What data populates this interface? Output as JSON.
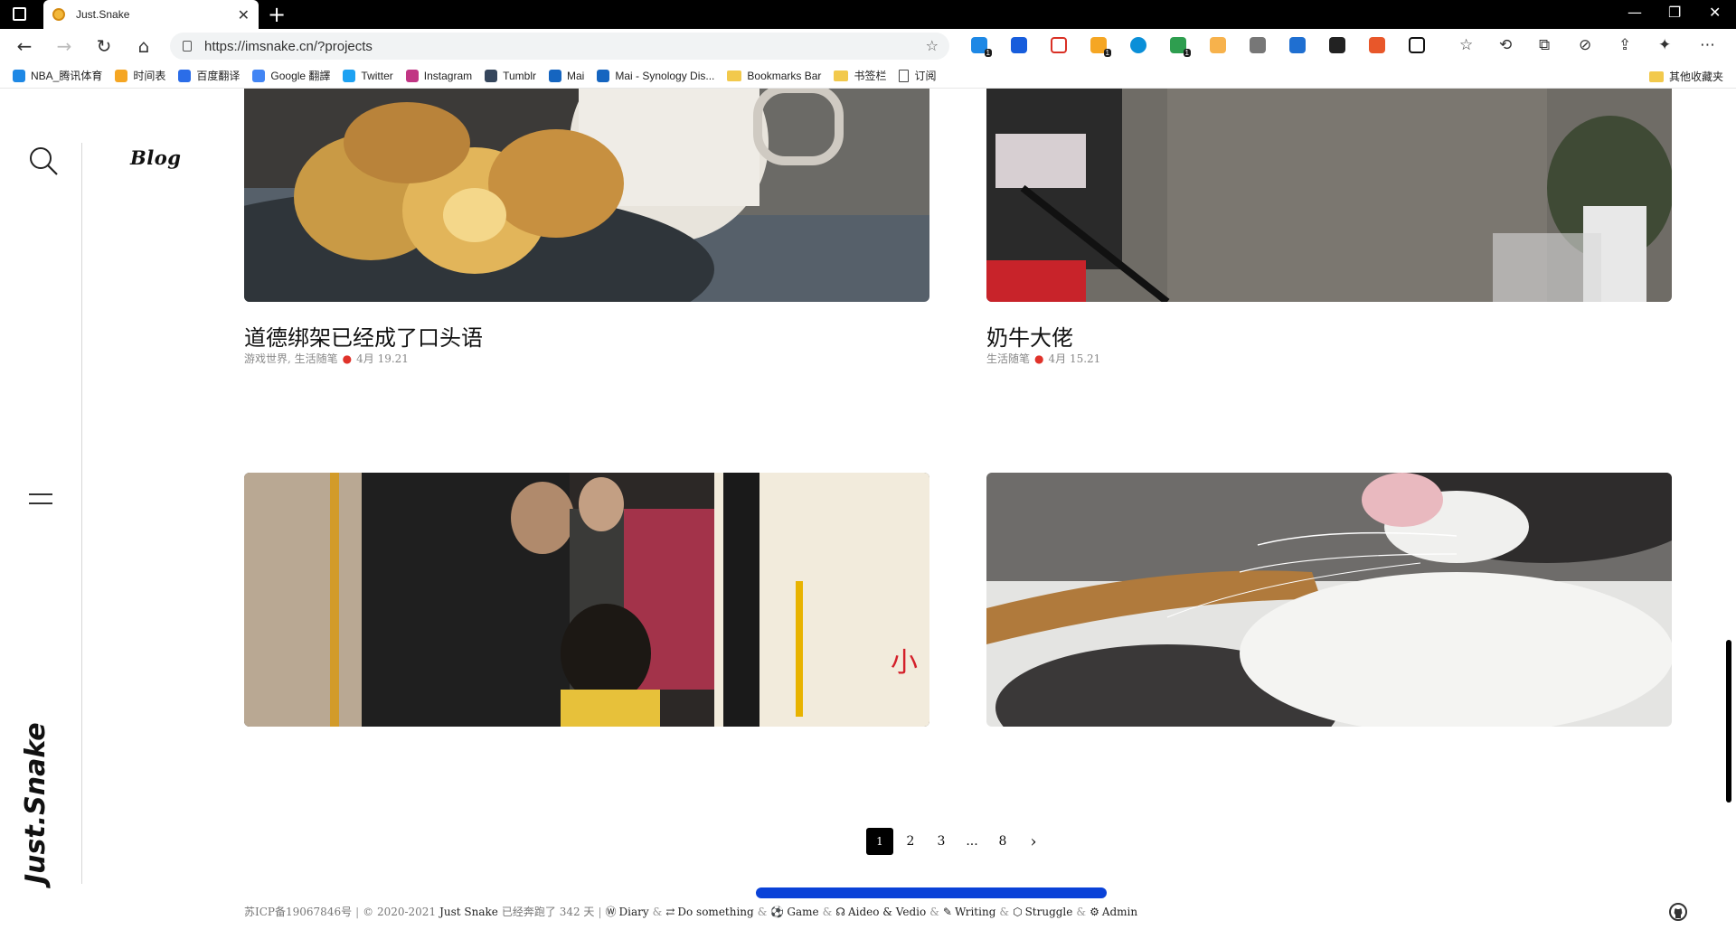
{
  "browser": {
    "tab_title": "Just.Snake",
    "url": "https://imsnake.cn/?projects",
    "bookmarks": [
      {
        "label": "NBA_腾讯体育",
        "color": "#1e88e5"
      },
      {
        "label": "时间表",
        "color": "#f5a623"
      },
      {
        "label": "百度翻译",
        "color": "#2b6de8"
      },
      {
        "label": "Google 翻譯",
        "color": "#4285f4"
      },
      {
        "label": "Twitter",
        "color": "#1da1f2"
      },
      {
        "label": "Instagram",
        "color": "#c13584"
      },
      {
        "label": "Tumblr",
        "color": "#35465c"
      },
      {
        "label": "Mai",
        "color": "#1565c0"
      },
      {
        "label": "Mai - Synology Dis...",
        "color": "#1565c0"
      },
      {
        "label": "Bookmarks Bar",
        "color": "folder"
      },
      {
        "label": "书签栏",
        "color": "folder"
      },
      {
        "label": "订阅",
        "color": "page"
      }
    ],
    "other_bookmarks": "其他收藏夹"
  },
  "site": {
    "blog_logo": "Blog",
    "brand": "Just.Snake"
  },
  "posts": [
    {
      "title": "道德绑架已经成了口头语",
      "categories": "游戏世界, 生活随笔",
      "date": "4月 19.21"
    },
    {
      "title": "奶牛大佬",
      "categories": "生活随笔",
      "date": "4月 15.21"
    }
  ],
  "pagination": {
    "pages": [
      "1",
      "2",
      "3",
      "...",
      "8"
    ],
    "current": "1"
  },
  "footer": {
    "icp": "苏ICP备19067846号",
    "copyright": "© 2020-2021",
    "site_name": "Just Snake",
    "running": "已经奔跑了 342 天",
    "links": [
      "Diary",
      "Do something",
      "Game",
      "Aideo & Vedio",
      "Writing",
      "Struggle",
      "Admin"
    ]
  },
  "colors": {
    "accent_progress": "#0a42d8",
    "meta_dot": "#e0322a"
  }
}
